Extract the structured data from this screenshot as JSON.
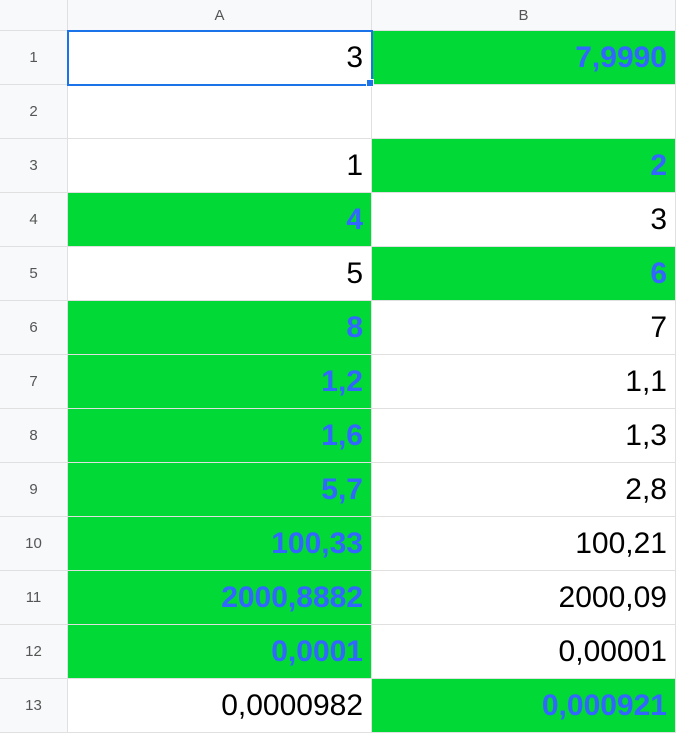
{
  "columns": [
    "A",
    "B"
  ],
  "rows": [
    "1",
    "2",
    "3",
    "4",
    "5",
    "6",
    "7",
    "8",
    "9",
    "10",
    "11",
    "12",
    "13"
  ],
  "selected": "A1",
  "cells": {
    "A1": {
      "value": "3",
      "highlight": false
    },
    "B1": {
      "value": "7,9990",
      "highlight": true
    },
    "A2": {
      "value": "",
      "highlight": false
    },
    "B2": {
      "value": "",
      "highlight": false
    },
    "A3": {
      "value": "1",
      "highlight": false
    },
    "B3": {
      "value": "2",
      "highlight": true
    },
    "A4": {
      "value": "4",
      "highlight": true
    },
    "B4": {
      "value": "3",
      "highlight": false
    },
    "A5": {
      "value": "5",
      "highlight": false
    },
    "B5": {
      "value": "6",
      "highlight": true
    },
    "A6": {
      "value": "8",
      "highlight": true
    },
    "B6": {
      "value": "7",
      "highlight": false
    },
    "A7": {
      "value": "1,2",
      "highlight": true
    },
    "B7": {
      "value": "1,1",
      "highlight": false
    },
    "A8": {
      "value": "1,6",
      "highlight": true
    },
    "B8": {
      "value": "1,3",
      "highlight": false
    },
    "A9": {
      "value": "5,7",
      "highlight": true
    },
    "B9": {
      "value": "2,8",
      "highlight": false
    },
    "A10": {
      "value": "100,33",
      "highlight": true
    },
    "B10": {
      "value": "100,21",
      "highlight": false
    },
    "A11": {
      "value": "2000,8882",
      "highlight": true
    },
    "B11": {
      "value": "2000,09",
      "highlight": false
    },
    "A12": {
      "value": "0,0001",
      "highlight": true
    },
    "B12": {
      "value": "0,00001",
      "highlight": false
    },
    "A13": {
      "value": "0,0000982",
      "highlight": false
    },
    "B13": {
      "value": "0,000921",
      "highlight": true
    }
  }
}
